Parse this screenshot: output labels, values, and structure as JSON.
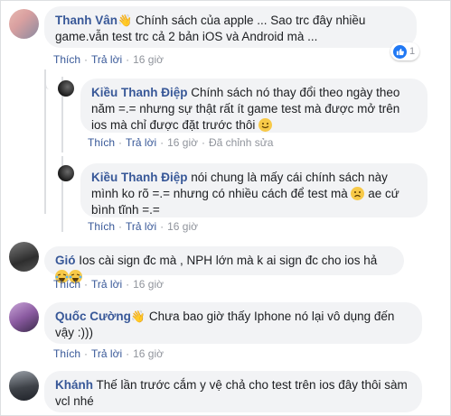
{
  "comments": [
    {
      "author": "Thanh Vân",
      "text": " Chính sách của apple ... Sao trc đây nhiều game.vẫn test trc cả 2 bản iOS và Android mà ...",
      "actions": {
        "like": "Thích",
        "reply": "Trả lời",
        "time": "16 giờ"
      },
      "reactions": "1",
      "replies": [
        {
          "author": "Kiều Thanh Điệp",
          "text": " Chính sách nó thay đổi theo ngày theo năm =.= nhưng sự thật rất ít game test mà được mở trên ios mà chỉ được đặt trước thôi ",
          "actions": {
            "like": "Thích",
            "reply": "Trả lời",
            "time": "16 giờ",
            "edited": "Đã chỉnh sửa"
          }
        },
        {
          "author": "Kiều Thanh Điệp",
          "text": " nói chung là mấy cái chính sách này mình ko rõ =.= nhưng có nhiều cách để test mà ",
          "text2": " ae cứ bình tĩnh =.=",
          "actions": {
            "like": "Thích",
            "reply": "Trả lời",
            "time": "16 giờ"
          }
        }
      ]
    },
    {
      "author": "Gió",
      "text": " Ios cài sign đc mà , NPH lớn mà k ai sign đc cho ios hả ",
      "actions": {
        "like": "Thích",
        "reply": "Trả lời",
        "time": "16 giờ"
      }
    },
    {
      "author": "Quốc Cường",
      "text": " Chưa bao giờ thấy Iphone nó lại vô dụng đến vậy :)))",
      "actions": {
        "like": "Thích",
        "reply": "Trả lời",
        "time": "16 giờ"
      }
    },
    {
      "author": "Khánh",
      "text": " Thế lần trước cắm y vệ chả cho test trên ios đây thôi sàm vcl nhé"
    }
  ],
  "colors": {
    "link": "#385898",
    "bubble": "#f2f3f5",
    "meta": "#90949c",
    "like": "#2078f4"
  },
  "icons": [
    "wave-hand-icon",
    "like-reaction-icon",
    "smile-emoji-icon",
    "sad-emoji-icon",
    "laugh-cry-emoji-icon"
  ]
}
